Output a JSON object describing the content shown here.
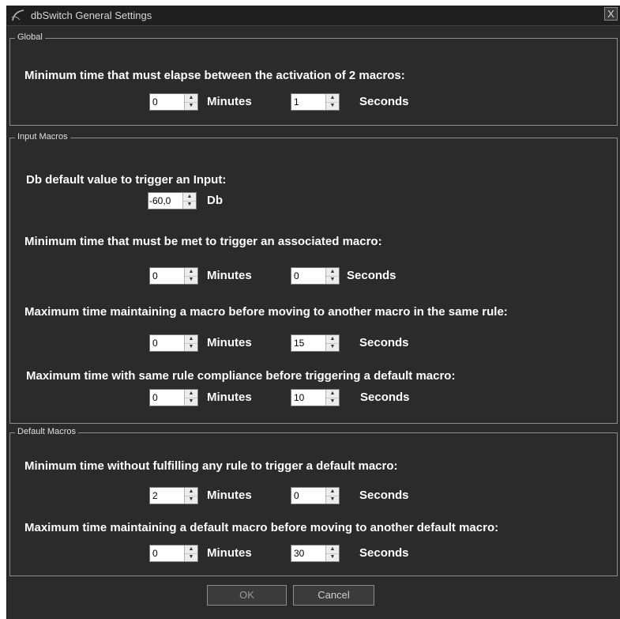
{
  "window": {
    "title": "dbSwitch General Settings",
    "close_label": "X"
  },
  "icons": {
    "app": "app-swirl-icon",
    "close": "close-icon",
    "spin_up": "spin-up-arrow",
    "spin_down": "spin-down-arrow"
  },
  "colors": {
    "background": "#2b2b2b",
    "titlebar": "#1f1f1f",
    "text": "#ffffff",
    "border": "#8e8e8e"
  },
  "global": {
    "label": "Global",
    "q1": {
      "text": "Minimum time that must elapse between the activation of 2 macros:",
      "minutes": "0",
      "seconds": "1"
    }
  },
  "input_macros": {
    "label": "Input Macros",
    "db": {
      "text": "Db default value to trigger an Input:",
      "value": "-60,0",
      "unit": "Db"
    },
    "q1": {
      "text": "Minimum time that must be met to trigger an associated macro:",
      "minutes": "0",
      "seconds": "0"
    },
    "q2": {
      "text": "Maximum time maintaining a macro before moving to another macro in the same rule:",
      "minutes": "0",
      "seconds": "15"
    },
    "q3": {
      "text": "Maximum time with same rule compliance before triggering a default macro:",
      "minutes": "0",
      "seconds": "10"
    }
  },
  "default_macros": {
    "label": "Default Macros",
    "q1": {
      "text": "Minimum time without fulfilling any rule to trigger a default macro:",
      "minutes": "2",
      "seconds": "0"
    },
    "q2": {
      "text": "Maximum time maintaining a default macro before moving to another default macro:",
      "minutes": "0",
      "seconds": "30"
    }
  },
  "units": {
    "minutes": "Minutes",
    "seconds": "Seconds"
  },
  "buttons": {
    "ok": "OK",
    "cancel": "Cancel"
  }
}
